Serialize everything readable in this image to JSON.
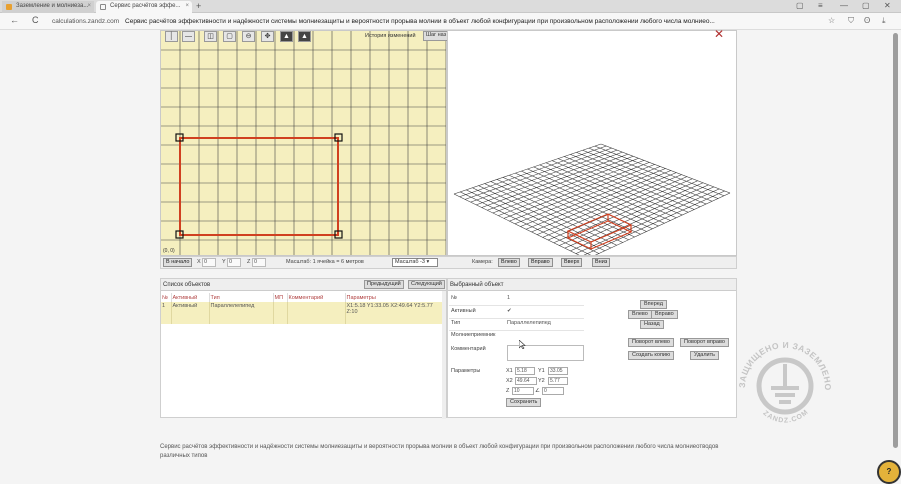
{
  "browser": {
    "tabs": [
      {
        "label": "Заземление и молниеза...",
        "close": "×"
      },
      {
        "label": "Сервис расчётов эффе...",
        "close": "×"
      }
    ],
    "new_tab": "+",
    "window_controls": [
      "▢",
      "≡",
      "—",
      "▢",
      "✕"
    ],
    "nav": {
      "back": "←",
      "reload": "C"
    },
    "url_domain": "calculations.zandz.com",
    "page_title": "Сервис расчётов эффективности и надёжности системы молниезащиты и вероятности прорыва молнии в объект любой конфигурации при произвольном расположении любого числа молниео...",
    "extensions": [
      "☆",
      "⛉",
      "ʘ",
      "⤓"
    ]
  },
  "toolbar": {
    "tools": [
      "│",
      "—",
      "◫",
      "▢",
      "⊖",
      "✥",
      "▲",
      "▲"
    ],
    "history_label": "История изменений",
    "history_button": "Шаг наз"
  },
  "plan": {
    "origin_label": "(0, 0)"
  },
  "controls": {
    "start_button": "В начало",
    "x_label": "X",
    "x_value": "0",
    "y_label": "Y",
    "y_value": "0",
    "z_label": "Z",
    "z_value": "0",
    "scale_text": "Масштаб: 1 ячейка = 6 метров",
    "scale_select": "Масштаб -3",
    "camera_label": "Камера:",
    "camera_buttons": [
      "Влево",
      "Вправо",
      "Вверх",
      "Вниз"
    ]
  },
  "object_list": {
    "title": "Список объектов",
    "prev": "Предыдущий",
    "next": "Следующий",
    "columns": [
      "№",
      "Активный",
      "Тип",
      "МП",
      "Комментарий",
      "Параметры"
    ],
    "rows": [
      {
        "n": "1",
        "active": "Активный",
        "type": "Параллелепипед",
        "mp": "",
        "comment": "",
        "params": "X1:5.18 Y1:33.05 X2:49.64 Y2:5.77 Z:10"
      }
    ]
  },
  "selected": {
    "title": "Выбранный объект",
    "fields": [
      {
        "key": "№",
        "value": "1"
      },
      {
        "key": "Активный",
        "value": "✔"
      },
      {
        "key": "Тип",
        "value": "Параллелепипед"
      },
      {
        "key": "Молниеприемник",
        "value": ""
      },
      {
        "key": "Комментарий",
        "value": ""
      },
      {
        "key": "Параметры",
        "value": ""
      }
    ],
    "params": {
      "x1_label": "X1",
      "x1": "5.18",
      "y1_label": "Y1",
      "y1": "33.05",
      "x2_label": "X2",
      "x2": "49.64",
      "y2_label": "Y2",
      "y2": "5.77",
      "z_label": "Z",
      "z": "10",
      "angle_label": "∠",
      "angle": "0"
    },
    "save": "Сохранить"
  },
  "actions": {
    "forward": "Вперед",
    "left": "Влево",
    "right": "Вправо",
    "back": "Назад",
    "rotate_left": "Поворот влево",
    "rotate_right": "Поворот вправо",
    "create_copy": "Создать копию",
    "delete": "Удалить"
  },
  "footer": {
    "description": "Сервис расчётов эффективности и надёжности системы молниезащиты и вероятности прорыва молнии в объект любой конфигурации при произвольном расположении любого числа молниеотводов различных типов"
  },
  "logo": {
    "top_text": "ЗАЩИЩЕНО И ЗАЗЕМЛЕНО",
    "bottom_text": "ZANDZ.COM"
  },
  "help": "?",
  "colors": {
    "plan_bg": "#f5efbf",
    "object_red": "#d04020",
    "grid_line": "#333333"
  }
}
